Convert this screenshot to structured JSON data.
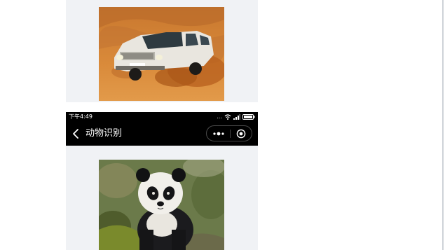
{
  "screens": [
    {
      "image": {
        "subject": "suv-in-desert-icon"
      }
    },
    {
      "status_bar": {
        "time": "下午4:49",
        "dots": "..."
      },
      "nav_bar": {
        "title": "动物识别"
      },
      "image": {
        "subject": "panda-icon"
      }
    }
  ],
  "colors": {
    "nav_background": "#000000",
    "page_background": "#f0f2f5",
    "text_on_nav": "#ffffff"
  }
}
